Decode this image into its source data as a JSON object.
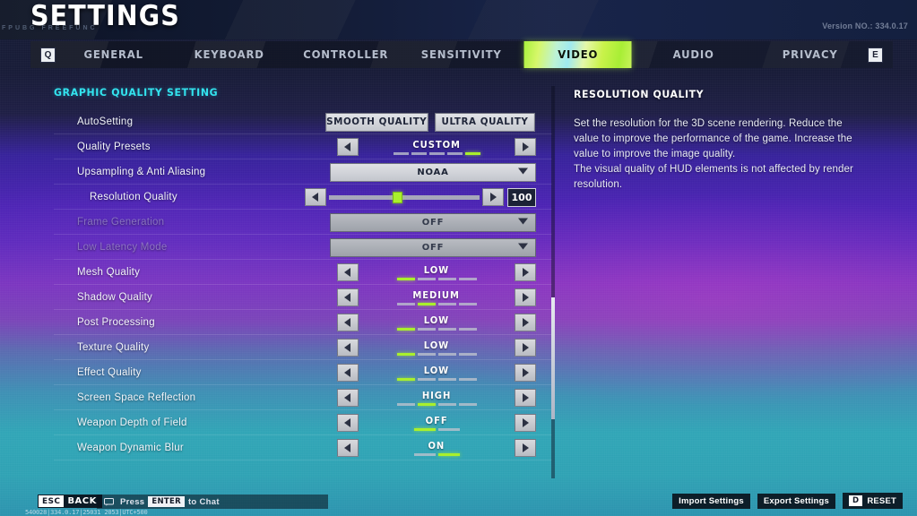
{
  "header": {
    "title": "SETTINGS",
    "subtitle": "FPUBG FREEFUNC",
    "version": "Version NO.: 334.0.17"
  },
  "tabs": {
    "left_key": "Q",
    "right_key": "E",
    "items": [
      {
        "label": "GENERAL",
        "active": false
      },
      {
        "label": "KEYBOARD",
        "active": false
      },
      {
        "label": "CONTROLLER",
        "active": false
      },
      {
        "label": "SENSITIVITY",
        "active": false
      },
      {
        "label": "VIDEO",
        "active": true
      },
      {
        "label": "AUDIO",
        "active": false
      },
      {
        "label": "PRIVACY",
        "active": false
      }
    ]
  },
  "settings": {
    "section_title": "GRAPHIC QUALITY SETTING",
    "rows": [
      {
        "label": "AutoSetting",
        "type": "buttons",
        "disabled": false,
        "indent": false,
        "buttons": [
          "SMOOTH QUALITY",
          "ULTRA QUALITY"
        ]
      },
      {
        "label": "Quality Presets",
        "type": "stepper",
        "disabled": false,
        "indent": false,
        "value": "CUSTOM",
        "segments": 5,
        "active_segment": 5
      },
      {
        "label": "Upsampling & Anti Aliasing",
        "type": "dropdown",
        "disabled": false,
        "indent": false,
        "value": "NOAA"
      },
      {
        "label": "Resolution Quality",
        "type": "slider",
        "disabled": false,
        "indent": true,
        "value": "100",
        "percent": 45,
        "min": 0,
        "max": 100
      },
      {
        "label": "Frame Generation",
        "type": "dropdown",
        "disabled": true,
        "indent": false,
        "value": "OFF"
      },
      {
        "label": "Low Latency Mode",
        "type": "dropdown",
        "disabled": true,
        "indent": false,
        "value": "OFF"
      },
      {
        "label": "Mesh Quality",
        "type": "stepper",
        "disabled": false,
        "indent": false,
        "value": "LOW",
        "segments": 4,
        "active_segment": 1
      },
      {
        "label": "Shadow Quality",
        "type": "stepper",
        "disabled": false,
        "indent": false,
        "value": "MEDIUM",
        "segments": 4,
        "active_segment": 2
      },
      {
        "label": "Post Processing",
        "type": "stepper",
        "disabled": false,
        "indent": false,
        "value": "LOW",
        "segments": 4,
        "active_segment": 1
      },
      {
        "label": "Texture Quality",
        "type": "stepper",
        "disabled": false,
        "indent": false,
        "value": "LOW",
        "segments": 4,
        "active_segment": 1
      },
      {
        "label": "Effect Quality",
        "type": "stepper",
        "disabled": false,
        "indent": false,
        "value": "LOW",
        "segments": 4,
        "active_segment": 1
      },
      {
        "label": "Screen Space Reflection",
        "type": "stepper",
        "disabled": false,
        "indent": false,
        "value": "HIGH",
        "segments": 4,
        "active_segment": 2
      },
      {
        "label": "Weapon Depth of Field",
        "type": "stepper",
        "disabled": false,
        "indent": false,
        "value": "OFF",
        "segments": 2,
        "active_segment": 1
      },
      {
        "label": "Weapon Dynamic Blur",
        "type": "stepper",
        "disabled": false,
        "indent": false,
        "value": "ON",
        "segments": 2,
        "active_segment": 2
      }
    ]
  },
  "info_panel": {
    "title": "RESOLUTION QUALITY",
    "paragraphs": [
      "Set the resolution for the 3D scene rendering. Reduce the",
      "value to improve the performance of the game. Increase the",
      "value to improve the image quality.",
      "The visual quality of HUD elements is not affected by render",
      "resolution."
    ]
  },
  "footer": {
    "esc_key": "ESC",
    "esc_label": "BACK",
    "chat_prefix": "Press",
    "chat_key": "ENTER",
    "chat_suffix": "to Chat",
    "build_info": "540028|334.0.17|25031 2053|UTC+500",
    "import_label": "Import Settings",
    "export_label": "Export Settings",
    "reset_key": "D",
    "reset_label": "RESET"
  },
  "colors": {
    "accent_green": "#a9f02c",
    "section_cyan": "#33e4ef",
    "tab_active_bg": "#bdf24a"
  }
}
